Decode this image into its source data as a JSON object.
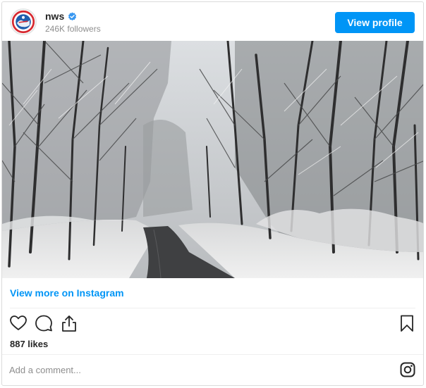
{
  "header": {
    "username": "nws",
    "verified": true,
    "followers": "246K followers",
    "view_profile_label": "View profile"
  },
  "post": {
    "image_description": "",
    "view_more_label": "View more on Instagram",
    "likes": "887 likes"
  },
  "comment": {
    "placeholder": "Add a comment..."
  },
  "colors": {
    "accent": "#0095f6",
    "text": "#262626",
    "muted": "#8e8e8e",
    "border": "#dbdbdb"
  },
  "icons": [
    "heart-icon",
    "comment-icon",
    "share-icon",
    "bookmark-icon",
    "instagram-icon",
    "verified-icon"
  ]
}
